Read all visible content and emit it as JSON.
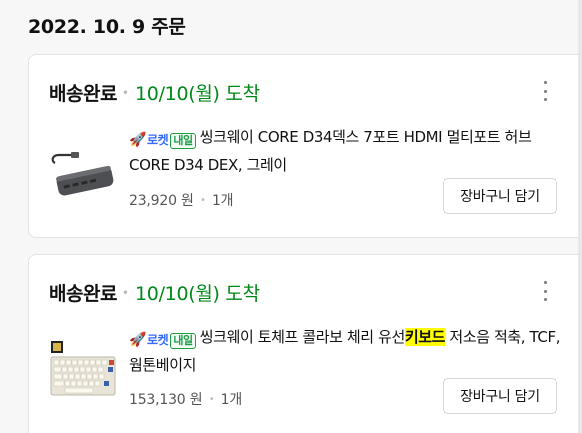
{
  "order_date": "2022. 10. 9 주문",
  "badge": {
    "rocket_label": "로켓",
    "delivery_day": "내일"
  },
  "orders": [
    {
      "status": "배송완료",
      "arrival": "10/10(월) 도착",
      "title": "씽크웨이 CORE D34덱스 7포트 HDMI 멀티포트 허브 CORE D34 DEX, 그레이",
      "price": "23,920 원",
      "qty": "1개",
      "cart_button": "장바구니 담기",
      "thumb_icon": "usb-hub-product-image"
    },
    {
      "status": "배송완료",
      "arrival": "10/10(월) 도착",
      "title_before": "씽크웨이 토체프 콜라보 체리 유선",
      "title_highlight": "키보드",
      "title_after": " 저소음 적축, TCF, 웜톤베이지",
      "price": "153,130 원",
      "qty": "1개",
      "cart_button": "장바구니 담기",
      "thumb_icon": "keyboard-product-image"
    }
  ]
}
